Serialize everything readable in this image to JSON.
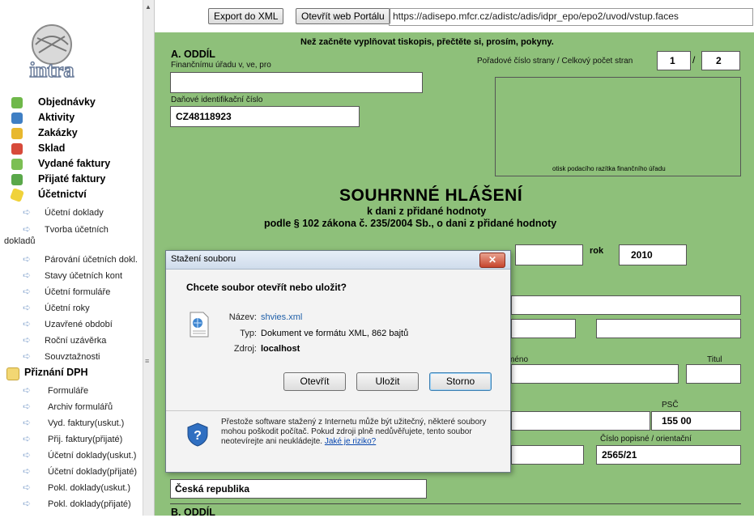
{
  "sidebar": {
    "logo_text": "intra",
    "main_items": [
      {
        "label": "Objednávky",
        "icon": "orders-icon"
      },
      {
        "label": "Aktivity",
        "icon": "activities-icon"
      },
      {
        "label": "Zakázky",
        "icon": "jobs-icon"
      },
      {
        "label": "Sklad",
        "icon": "warehouse-icon"
      },
      {
        "label": "Vydané faktury",
        "icon": "issued-invoices-icon"
      },
      {
        "label": "Přijaté faktury",
        "icon": "received-invoices-icon"
      },
      {
        "label": "Účetnictví",
        "icon": "accounting-icon"
      }
    ],
    "accounting_items": [
      {
        "label": "Účetní doklady"
      },
      {
        "label": "Tvorba účetních"
      },
      {
        "label": "dokladů"
      },
      {
        "label": "Párování účetních dokl."
      },
      {
        "label": "Stavy účetních kont"
      },
      {
        "label": "Účetní formuláře"
      },
      {
        "label": "Účetní roky"
      },
      {
        "label": "Uzavřené období"
      },
      {
        "label": "Roční uzávěrka"
      },
      {
        "label": "Souvztažnosti"
      }
    ],
    "vat_section": {
      "label": "Přiznání DPH",
      "icon": "folder-open-icon"
    },
    "vat_items": [
      {
        "label": "Formuláře"
      },
      {
        "label": "Archiv formulářů"
      },
      {
        "label": "Vyd. faktury(uskut.)"
      },
      {
        "label": "Přij. faktury(přijaté)"
      },
      {
        "label": "Účetní doklady(uskut.)"
      },
      {
        "label": "Účetní doklady(přijaté)"
      },
      {
        "label": "Pokl. doklady(uskut.)"
      },
      {
        "label": "Pokl. doklady(přijaté)"
      }
    ]
  },
  "toolbar": {
    "export_label": "Export do XML",
    "portal_label": "Otevřít web Portálu",
    "url": "https://adisepo.mfcr.cz/adistc/adis/idpr_epo/epo2/uvod/vstup.faces"
  },
  "form": {
    "instructions": "Než začněte vyplňovat tiskopis, přečtěte si, prosím, pokyny.",
    "section_a": "A. ODDÍL",
    "office_label": "Finančnímu úřadu v, ve, pro",
    "office_value": "",
    "page_label": "Pořadové číslo strany / Celkový počet stran",
    "page_current": "1",
    "page_sep": "/",
    "page_total": "2",
    "tax_id_label": "Daňové identifikační číslo",
    "tax_id_value": "CZ48118923",
    "stamp_label": "otisk podacího razítka finančního úřadu",
    "title": "SOUHRNNÉ HLÁŠENÍ",
    "subtitle1": "k dani z přidané hodnoty",
    "subtitle2": "podle § 102 zákona č. 235/2004 Sb., o dani z přidané hodnoty",
    "year_label": "rok",
    "year_value": "2010",
    "name_label": "méno",
    "title_label": "Titul",
    "psc_label": "PSČ",
    "psc_value": "155 00",
    "house_label": "Číslo popisné / orientační",
    "house_value": "2565/21",
    "country_value": "Česká republika",
    "section_b": "B. ODDÍL"
  },
  "dialog": {
    "title": "Stažení souboru",
    "close": "✕",
    "question": "Chcete soubor otevřít nebo uložit?",
    "name_label": "Název:",
    "name_value": "shvies.xml",
    "type_label": "Typ:",
    "type_value": "Dokument ve formátu XML, 862 bajtů",
    "source_label": "Zdroj:",
    "source_value": "localhost",
    "open_label": "Otevřít",
    "save_label": "Uložit",
    "cancel_label": "Storno",
    "warning_text": "Přestože software stažený z Internetu může být užitečný, některé soubory mohou poškodit počítač. Pokud zdroji plně nedůvěřujete, tento soubor neotevírejte ani neukládejte.",
    "warning_link": "Jaké je riziko?"
  },
  "colors": {
    "form_bg": "#8ec07a",
    "link": "#0645ad"
  }
}
